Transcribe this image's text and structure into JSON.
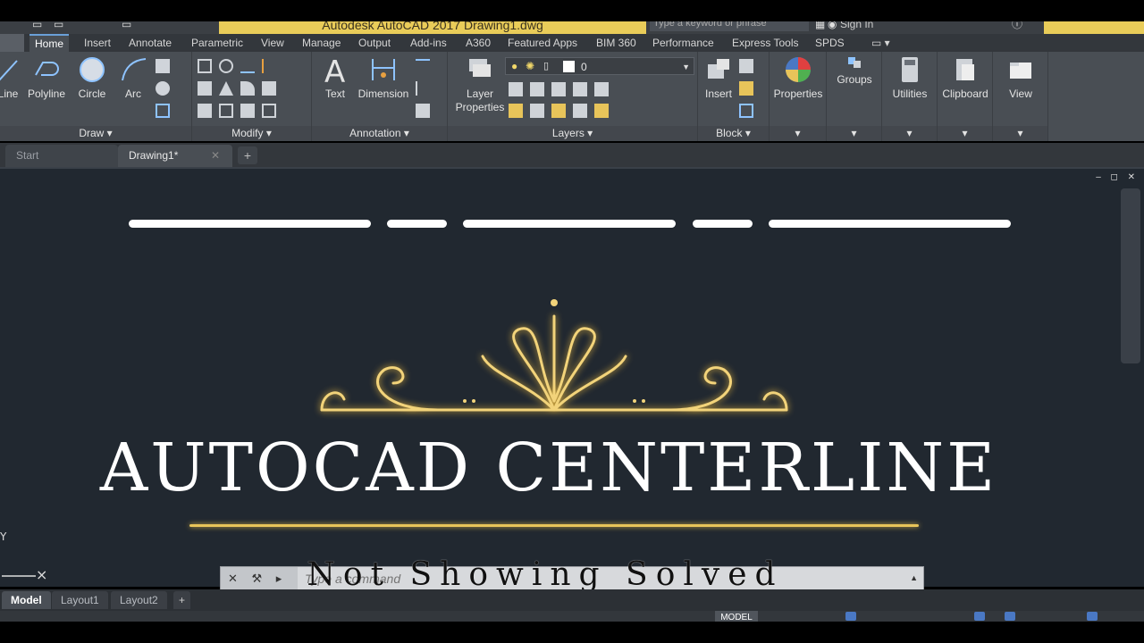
{
  "title_bar": {
    "title": "Autodesk AutoCAD 2017    Drawing1.dwg",
    "search_placeholder": "Type a keyword or phrase",
    "signin": "Sign In"
  },
  "ribbon_tabs": [
    "Home",
    "Insert",
    "Annotate",
    "Parametric",
    "View",
    "Manage",
    "Output",
    "Add-ins",
    "A360",
    "Featured Apps",
    "BIM 360",
    "Performance",
    "Express Tools",
    "SPDS"
  ],
  "ribbon": {
    "draw": {
      "line": "Line",
      "polyline": "Polyline",
      "circle": "Circle",
      "arc": "Arc",
      "footer": "Draw ▾"
    },
    "modify": {
      "footer": "Modify ▾"
    },
    "annotation": {
      "text": "Text",
      "dimension": "Dimension",
      "footer": "Annotation ▾"
    },
    "layers": {
      "layer_properties_line1": "Layer",
      "layer_properties_line2": "Properties",
      "current_layer": "0",
      "footer": "Layers ▾"
    },
    "block": {
      "insert": "Insert",
      "footer": "Block ▾"
    },
    "properties": {
      "label": "Properties",
      "footer": "▾"
    },
    "groups": {
      "label": "Groups",
      "footer": "▾"
    },
    "utilities": {
      "label": "Utilities",
      "footer": "▾"
    },
    "clipboard": {
      "label": "Clipboard",
      "footer": "▾"
    },
    "view": {
      "label": "View",
      "footer": "▾"
    }
  },
  "doc_tabs": {
    "start": "Start",
    "drawing": "Drawing1*",
    "close": "✕",
    "add": "+"
  },
  "canvas": {
    "headline": "AUTOCAD CENTERLINE",
    "ucs_y": "Y",
    "controls": "– ◻ ✕"
  },
  "command_line": {
    "placeholder": "Type a command",
    "left": "✕ ⚒ ▸",
    "caret": "▲"
  },
  "overlay_caption": "Not Showing Solved",
  "layout_tabs": {
    "model": "Model",
    "layout1": "Layout1",
    "layout2": "Layout2",
    "add": "+"
  },
  "status_bar": {
    "model": "MODEL"
  },
  "colors": {
    "gold": "#e8c45a",
    "canvas_bg": "#212830",
    "title_strip": "#e9cc59"
  }
}
